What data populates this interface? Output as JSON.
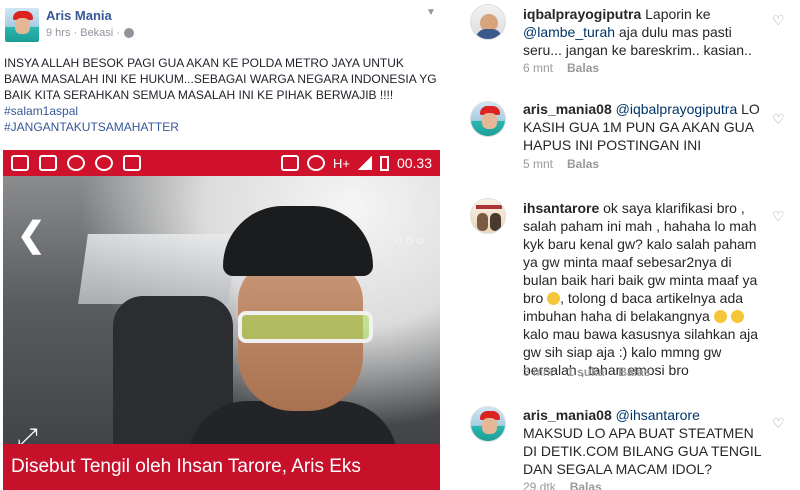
{
  "facebook": {
    "author": "Aris Mania",
    "meta": "9 hrs · Bekasi ·",
    "post_text": "INSYA ALLAH BESOK PAGI GUA AKAN KE POLDA METRO JAYA UNTUK BAWA MASALAH INI KE HUKUM...SEBAGAI WARGA NEGARA INDONESIA YG BAIK KITA SERAHKAN SEMUA MASALAH INI KE PIHAK BERWAJIB !!!!",
    "hashtags": [
      "#salam1aspal",
      "#JANGANTAKUTSAMAHATTER"
    ],
    "phone": {
      "time": "00.33",
      "network": "H+",
      "caption": "Disebut Tengil oleh Ihsan Tarore, Aris Eks"
    }
  },
  "instagram": {
    "comments": [
      {
        "user": "iqbalprayogiputra",
        "text_before": "Laporin ke ",
        "mention": "@lambe_turah",
        "text_after": " aja dulu mas pasti seru... jangan ke bareskrim.. kasian..",
        "time": "6 mnt",
        "likes": "",
        "reply": "Balas"
      },
      {
        "user": "aris_mania08",
        "text_before": " ",
        "mention": "@iqbalprayogiputra",
        "text_after": " LO KASIH GUA 1M PUN GA AKAN GUA HAPUS INI POSTINGAN  INI",
        "time": "5 mnt",
        "likes": "",
        "reply": "Balas"
      },
      {
        "user": "ihsantarore",
        "text_before": " ok saya klarifikasi bro , salah paham ini mah , hahaha lo mah kyk baru kenal gw? kalo salah paham ya gw minta maaf sebesar2nya di bulan baik hari baik gw minta maaf ya bro ",
        "text_mid": ", tolong d baca artikelnya ada imbuhan haha di belakangnya ",
        "text_after": " kalo mau bawa kasusnya silahkan aja gw sih siap aja :) kalo mmng gw bersalah , tahan emosi bro",
        "time": "3 mnt",
        "likes": "1 suka",
        "reply": "Balas"
      },
      {
        "user": "aris_mania08",
        "text_before": " ",
        "mention": "@ihsantarore",
        "text_after": " MAKSUD LO APA BUAT STEATMEN DI DETIK.COM BILANG GUA TENGIL DAN SEGALA MACAM IDOL?",
        "time": "29 dtk",
        "likes": "",
        "reply": "Balas"
      }
    ]
  }
}
